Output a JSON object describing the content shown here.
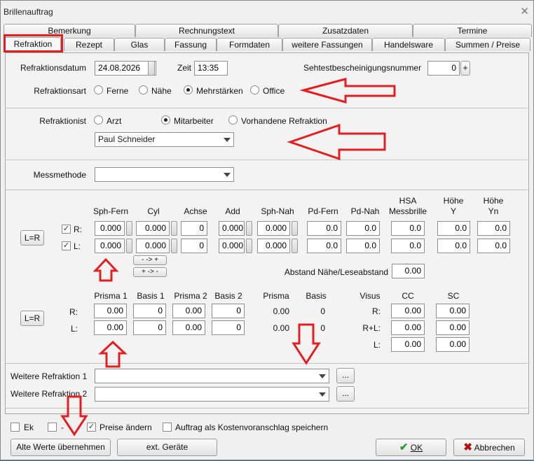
{
  "window": {
    "title": "Brillenauftrag",
    "close": "✕"
  },
  "tabs_back": [
    "Bemerkung",
    "Rechnungstext",
    "Zusatzdaten",
    "Termine"
  ],
  "tabs_front": [
    "Refraktion",
    "Rezept",
    "Glas",
    "Fassung",
    "Formdaten",
    "weitere Fassungen",
    "Handelsware",
    "Summen / Preise"
  ],
  "header": {
    "datum_label": "Refraktionsdatum",
    "datum_value": "24.08.2026",
    "zeit_label": "Zeit",
    "zeit_value": "13:35",
    "seh_label": "Sehtestbescheinigungsnummer",
    "seh_value": "0",
    "plus": "+"
  },
  "refraktionsart": {
    "label": "Refraktionsart",
    "options": [
      "Ferne",
      "Nähe",
      "Mehrstärken",
      "Office"
    ],
    "selected": "Mehrstärken"
  },
  "refraktionist": {
    "label": "Refraktionist",
    "options": [
      "Arzt",
      "Mitarbeiter",
      "Vorhandene Refraktion"
    ],
    "selected": "Mitarbeiter",
    "person": "Paul Schneider"
  },
  "messmethode": {
    "label": "Messmethode",
    "value": ""
  },
  "grid1": {
    "headers": [
      "Sph-Fern",
      "Cyl",
      "Achse",
      "Add",
      "Sph-Nah",
      "Pd-Fern",
      "Pd-Nah",
      "HSA\nMessbrille",
      "Höhe\nY",
      "Höhe\nYn"
    ],
    "row_r_label": "R:",
    "row_l_label": "L:",
    "r": [
      "0.000",
      "0.000",
      "0",
      "0.000",
      "0.000",
      "0.0",
      "0.0",
      "0.0",
      "0.0",
      "0.0"
    ],
    "l": [
      "0.000",
      "0.000",
      "0",
      "0.000",
      "0.000",
      "0.0",
      "0.0",
      "0.0",
      "0.0",
      "0.0"
    ],
    "leq": "L=R",
    "swap1": "- -> +",
    "swap2": "+ -> -",
    "abstand_label": "Abstand Nähe/Leseabstand",
    "abstand_value": "0.00"
  },
  "grid2": {
    "headers": [
      "Prisma 1",
      "Basis 1",
      "Prisma 2",
      "Basis 2",
      "Prisma",
      "Basis",
      "Visus",
      "CC",
      "SC"
    ],
    "row_r_label": "R:",
    "row_l_label": "L:",
    "r": [
      "0.00",
      "0",
      "0.00",
      "0",
      "0.00",
      "0"
    ],
    "l": [
      "0.00",
      "0",
      "0.00",
      "0",
      "0.00",
      "0"
    ],
    "visus_labels": [
      "R:",
      "R+L:",
      "L:"
    ],
    "cc": [
      "0.00",
      "0.00",
      "0.00"
    ],
    "sc": [
      "0.00",
      "0.00",
      "0.00"
    ],
    "leq": "L=R"
  },
  "weitere": {
    "label1": "Weitere Refraktion 1",
    "label2": "Weitere Refraktion 2",
    "value1": "",
    "value2": "",
    "dots": "..."
  },
  "footer": {
    "ek": "Ek",
    "dash": "-",
    "preise": "Preise ändern",
    "auftrag": "Auftrag als Kostenvoranschlag speichern",
    "alte": "Alte Werte übernehmen",
    "ext": "ext. Geräte",
    "ok": "OK",
    "abbrechen": "Abbrechen"
  },
  "colors": {
    "annotation": "#e02020",
    "ok_check": "#2a9a2a",
    "cancel_x": "#b01010"
  }
}
